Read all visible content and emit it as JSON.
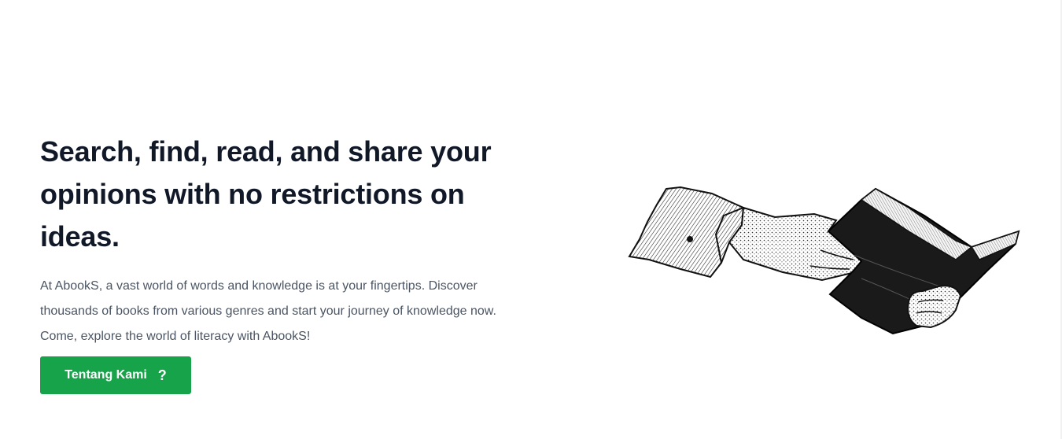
{
  "hero": {
    "title": "Search, find, read, and share your opinions with no restrictions on ideas.",
    "description": "At AbookS, a vast world of words and knowledge is at your fingertips. Discover thousands of books from various genres and start your journey of knowledge now. Come, explore the world of literacy with AbookS!",
    "cta_label": "Tentang Kami",
    "cta_icon": "question-mark-icon",
    "cta_icon_glyph": "?"
  },
  "colors": {
    "accent": "#16a34a",
    "heading": "#111827",
    "body_text": "#4b5563",
    "background": "#ffffff"
  }
}
